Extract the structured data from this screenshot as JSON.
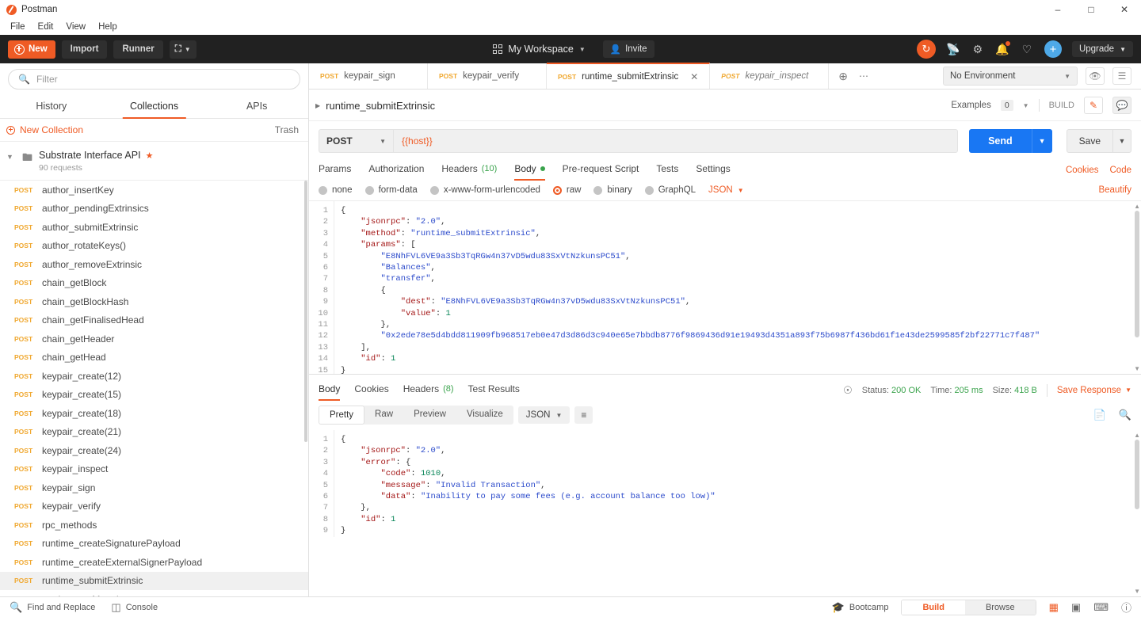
{
  "window": {
    "title": "Postman",
    "logo_icon": "postman-logo-icon",
    "minimize": "–",
    "maximize": "□",
    "close": "✕"
  },
  "menubar": [
    "File",
    "Edit",
    "View",
    "Help"
  ],
  "toolbar": {
    "new_label": "New",
    "import_label": "Import",
    "runner_label": "Runner",
    "workspace_label": "My Workspace",
    "invite_label": "Invite",
    "upgrade_label": "Upgrade",
    "icons": [
      "sync-icon",
      "satellite-icon",
      "gear-icon",
      "bell-icon",
      "heart-icon",
      "add-account-icon"
    ]
  },
  "sidebar": {
    "filter_placeholder": "Filter",
    "tabs": [
      {
        "label": "History",
        "active": false
      },
      {
        "label": "Collections",
        "active": true
      },
      {
        "label": "APIs",
        "active": false
      }
    ],
    "new_collection_label": "New Collection",
    "trash_label": "Trash",
    "collection": {
      "name": "Substrate Interface API",
      "subtitle": "90 requests",
      "starred": true
    },
    "requests": [
      {
        "method": "POST",
        "name": "author_insertKey",
        "selected": false
      },
      {
        "method": "POST",
        "name": "author_pendingExtrinsics",
        "selected": false
      },
      {
        "method": "POST",
        "name": "author_submitExtrinsic",
        "selected": false
      },
      {
        "method": "POST",
        "name": "author_rotateKeys()",
        "selected": false
      },
      {
        "method": "POST",
        "name": "author_removeExtrinsic",
        "selected": false
      },
      {
        "method": "POST",
        "name": "chain_getBlock",
        "selected": false
      },
      {
        "method": "POST",
        "name": "chain_getBlockHash",
        "selected": false
      },
      {
        "method": "POST",
        "name": "chain_getFinalisedHead",
        "selected": false
      },
      {
        "method": "POST",
        "name": "chain_getHeader",
        "selected": false
      },
      {
        "method": "POST",
        "name": "chain_getHead",
        "selected": false
      },
      {
        "method": "POST",
        "name": "keypair_create(12)",
        "selected": false
      },
      {
        "method": "POST",
        "name": "keypair_create(15)",
        "selected": false
      },
      {
        "method": "POST",
        "name": "keypair_create(18)",
        "selected": false
      },
      {
        "method": "POST",
        "name": "keypair_create(21)",
        "selected": false
      },
      {
        "method": "POST",
        "name": "keypair_create(24)",
        "selected": false
      },
      {
        "method": "POST",
        "name": "keypair_inspect",
        "selected": false
      },
      {
        "method": "POST",
        "name": "keypair_sign",
        "selected": false
      },
      {
        "method": "POST",
        "name": "keypair_verify",
        "selected": false
      },
      {
        "method": "POST",
        "name": "rpc_methods",
        "selected": false
      },
      {
        "method": "POST",
        "name": "runtime_createSignaturePayload",
        "selected": false
      },
      {
        "method": "POST",
        "name": "runtime_createExternalSignerPayload",
        "selected": false
      },
      {
        "method": "POST",
        "name": "runtime_submitExtrinsic",
        "selected": true
      },
      {
        "method": "POST",
        "name": "runtime_getMetadata",
        "selected": false
      }
    ]
  },
  "request_tabs": [
    {
      "method": "POST",
      "name": "keypair_sign",
      "active": false,
      "italic": false
    },
    {
      "method": "POST",
      "name": "keypair_verify",
      "active": false,
      "italic": false
    },
    {
      "method": "POST",
      "name": "runtime_submitExtrinsic",
      "active": true,
      "italic": false
    },
    {
      "method": "POST",
      "name": "keypair_inspect",
      "active": false,
      "italic": true
    }
  ],
  "environment": {
    "selected": "No Environment",
    "eye_icon": "eye-icon",
    "settings_icon": "env-settings-icon"
  },
  "request": {
    "title": "runtime_submitExtrinsic",
    "examples_label": "Examples",
    "examples_count": "0",
    "build_label": "BUILD",
    "method": "POST",
    "url": "{{host}}",
    "send_label": "Send",
    "save_label": "Save",
    "tabs": [
      {
        "label": "Params",
        "active": false,
        "count": ""
      },
      {
        "label": "Authorization",
        "active": false,
        "count": ""
      },
      {
        "label": "Headers",
        "active": false,
        "count": "(10)"
      },
      {
        "label": "Body",
        "active": true,
        "count": ""
      },
      {
        "label": "Pre-request Script",
        "active": false,
        "count": ""
      },
      {
        "label": "Tests",
        "active": false,
        "count": ""
      },
      {
        "label": "Settings",
        "active": false,
        "count": ""
      }
    ],
    "cookies_link": "Cookies",
    "code_link": "Code",
    "body_options": [
      {
        "label": "none",
        "selected": false
      },
      {
        "label": "form-data",
        "selected": false
      },
      {
        "label": "x-www-form-urlencoded",
        "selected": false
      },
      {
        "label": "raw",
        "selected": true
      },
      {
        "label": "binary",
        "selected": false
      },
      {
        "label": "GraphQL",
        "selected": false
      }
    ],
    "format": "JSON",
    "beautify_label": "Beautify",
    "body_lines": [
      {
        "n": "1",
        "text": "{"
      },
      {
        "n": "2",
        "text": "    \"jsonrpc\": \"2.0\","
      },
      {
        "n": "3",
        "text": "    \"method\": \"runtime_submitExtrinsic\","
      },
      {
        "n": "4",
        "text": "    \"params\": ["
      },
      {
        "n": "5",
        "text": "        \"E8NhFVL6VE9a3Sb3TqRGw4n37vD5wdu83SxVtNzkunsPC51\","
      },
      {
        "n": "6",
        "text": "        \"Balances\","
      },
      {
        "n": "7",
        "text": "        \"transfer\","
      },
      {
        "n": "8",
        "text": "        {"
      },
      {
        "n": "9",
        "text": "            \"dest\": \"E8NhFVL6VE9a3Sb3TqRGw4n37vD5wdu83SxVtNzkunsPC51\","
      },
      {
        "n": "10",
        "text": "            \"value\": 1"
      },
      {
        "n": "11",
        "text": "        },"
      },
      {
        "n": "12",
        "text": "        \"0x2ede78e5d4bdd811909fb968517eb0e47d3d86d3c940e65e7bbdb8776f9869436d91e19493d4351a893f75b6987f436bd61f1e43de2599585f2bf22771c7f487\""
      },
      {
        "n": "13",
        "text": "    ],"
      },
      {
        "n": "14",
        "text": "    \"id\": 1"
      },
      {
        "n": "15",
        "text": "}"
      }
    ]
  },
  "response": {
    "tabs": [
      {
        "label": "Body",
        "active": true,
        "count": ""
      },
      {
        "label": "Cookies",
        "active": false,
        "count": ""
      },
      {
        "label": "Headers",
        "active": false,
        "count": "(8)"
      },
      {
        "label": "Test Results",
        "active": false,
        "count": ""
      }
    ],
    "status_label": "Status:",
    "status_value": "200 OK",
    "time_label": "Time:",
    "time_value": "205 ms",
    "size_label": "Size:",
    "size_value": "418 B",
    "save_response_label": "Save Response",
    "view_modes": [
      {
        "label": "Pretty",
        "active": true
      },
      {
        "label": "Raw",
        "active": false
      },
      {
        "label": "Preview",
        "active": false
      },
      {
        "label": "Visualize",
        "active": false
      }
    ],
    "format": "JSON",
    "wrap_icon": "word-wrap-icon",
    "copy_icon": "copy-icon",
    "search_icon": "search-icon",
    "body_lines": [
      {
        "n": "1",
        "text": "{"
      },
      {
        "n": "2",
        "text": "    \"jsonrpc\": \"2.0\","
      },
      {
        "n": "3",
        "text": "    \"error\": {"
      },
      {
        "n": "4",
        "text": "        \"code\": 1010,"
      },
      {
        "n": "5",
        "text": "        \"message\": \"Invalid Transaction\","
      },
      {
        "n": "6",
        "text": "        \"data\": \"Inability to pay some fees (e.g. account balance too low)\""
      },
      {
        "n": "7",
        "text": "    },"
      },
      {
        "n": "8",
        "text": "    \"id\": 1"
      },
      {
        "n": "9",
        "text": "}"
      }
    ]
  },
  "statusbar": {
    "find_replace_label": "Find and Replace",
    "console_label": "Console",
    "bootcamp_label": "Bootcamp",
    "build_label": "Build",
    "browse_label": "Browse",
    "icons": [
      "two-pane-icon",
      "single-pane-icon",
      "keyboard-icon",
      "help-icon"
    ]
  },
  "colors": {
    "accent": "#ef5b25",
    "send": "#1977f3",
    "method": "#f0a830",
    "success": "#3aa34c",
    "toolbar_bg": "#212121"
  }
}
